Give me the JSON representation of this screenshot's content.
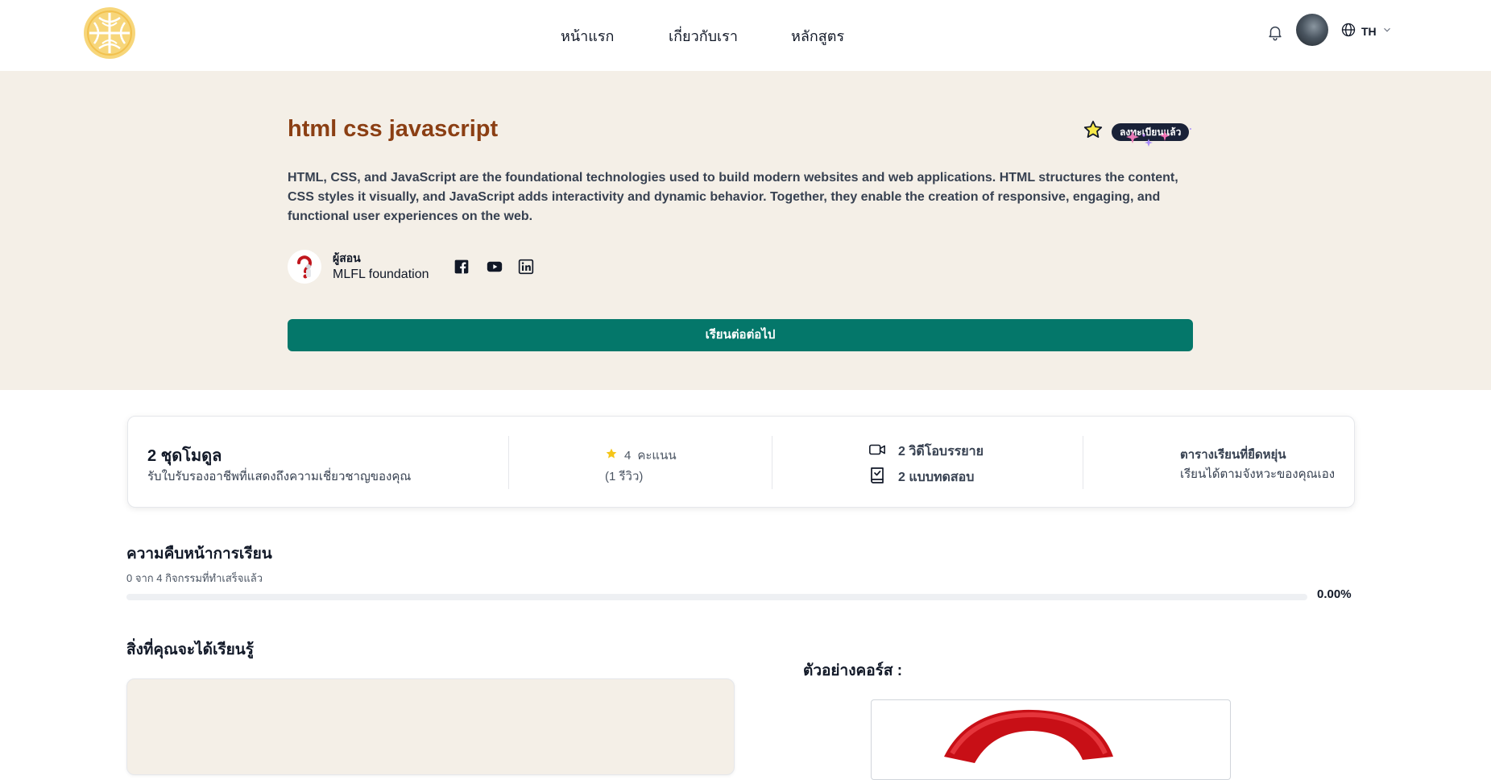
{
  "header": {
    "logo_icon": "gold-emblem-logo",
    "nav": [
      "หน้าแรก",
      "เกี่ยวกับเรา",
      "หลักสูตร"
    ],
    "bell_icon": "bell-icon",
    "lang_code": "TH"
  },
  "hero": {
    "title": "html css javascript",
    "enrolled_badge": "ลงทะเบียนแล้ว",
    "description": "HTML, CSS, and JavaScript are the foundational technologies used to build modern websites and web applications. HTML structures the content, CSS styles it visually, and JavaScript adds interactivity and dynamic behavior. Together, they enable the creation of responsive, engaging, and functional user experiences on the web.",
    "instructor_role": "ผู้สอน",
    "instructor_name": "MLFL foundation",
    "socials": [
      "facebook-icon",
      "youtube-icon",
      "linkedin-icon"
    ],
    "cta_label": "เรียนต่อต่อไป"
  },
  "stats": {
    "modules_title": "2 ชุดโมดูล",
    "modules_sub": "รับใบรับรองอาชีพที่แสดงถึงความเชี่ยวชาญของคุณ",
    "rating_value": "4",
    "rating_label": "คะแนน",
    "reviews": "(1 รีวิว)",
    "videos": "2 วิดีโอบรรยาย",
    "quizzes": "2 แบบทดสอบ",
    "schedule_title": "ตารางเรียนที่ยืดหยุ่น",
    "schedule_sub": "เรียนได้ตามจังหวะของคุณเอง"
  },
  "progress": {
    "title": "ความคืบหน้าการเรียน",
    "subtitle": "0 จาก 4 กิจกรรมที่ทำเสร็จแล้ว",
    "percent_text": "0.00%",
    "fraction": 0
  },
  "learn": {
    "title": "สิ่งที่คุณจะได้เรียนรู้"
  },
  "preview": {
    "title": "ตัวอย่างคอร์ส :"
  },
  "colors": {
    "accent": "#04776a",
    "title": "#8b3f14",
    "hero_bg": "#f4efe7",
    "badge_bg": "#1a2238",
    "star": "#f5c518"
  }
}
